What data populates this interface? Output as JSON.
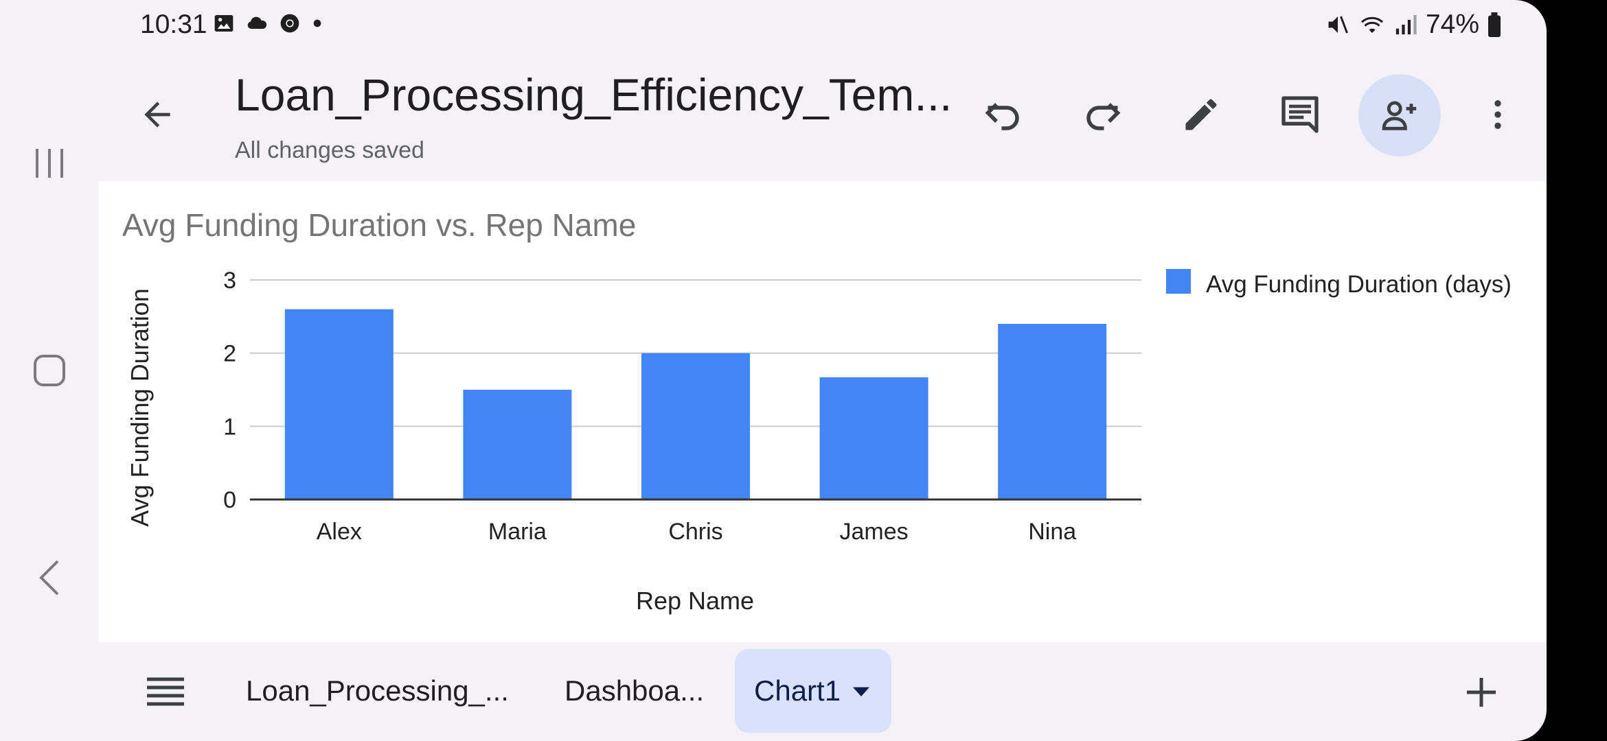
{
  "status_bar": {
    "time": "10:31",
    "battery": "74%",
    "icons": [
      "gallery-icon",
      "cloud-icon",
      "chrome-icon",
      "dot-icon",
      "mute-icon",
      "wifi-icon",
      "signal-icon",
      "battery-icon"
    ]
  },
  "toolbar": {
    "title": "Loan_Processing_Efficiency_Tem...",
    "save_status": "All changes saved",
    "icons": [
      "back-arrow-icon",
      "undo-icon",
      "redo-icon",
      "edit-pencil-icon",
      "comment-icon",
      "add-person-icon",
      "more-vert-icon"
    ]
  },
  "colors": {
    "bar": "#4285f4",
    "accent_bg": "#d9e1fb",
    "screen_bg": "#f4f2f7"
  },
  "chart_data": {
    "type": "bar",
    "title": "Avg Funding Duration vs. Rep Name",
    "xlabel": "Rep Name",
    "ylabel": "Avg Funding Duration",
    "categories": [
      "Alex",
      "Maria",
      "Chris",
      "James",
      "Nina"
    ],
    "series": [
      {
        "name": "Avg Funding Duration (days)",
        "values": [
          2.6,
          1.5,
          2.0,
          1.67,
          2.4
        ]
      }
    ],
    "ylim": [
      0,
      3
    ],
    "yticks": [
      "0",
      "1",
      "2",
      "3"
    ],
    "grid": true,
    "legend": "top-right"
  },
  "bottom_bar": {
    "tabs": [
      {
        "label": "Loan_Processing_..."
      },
      {
        "label": "Dashboa..."
      },
      {
        "label": "Chart1"
      }
    ],
    "active_tab": "Chart1"
  }
}
